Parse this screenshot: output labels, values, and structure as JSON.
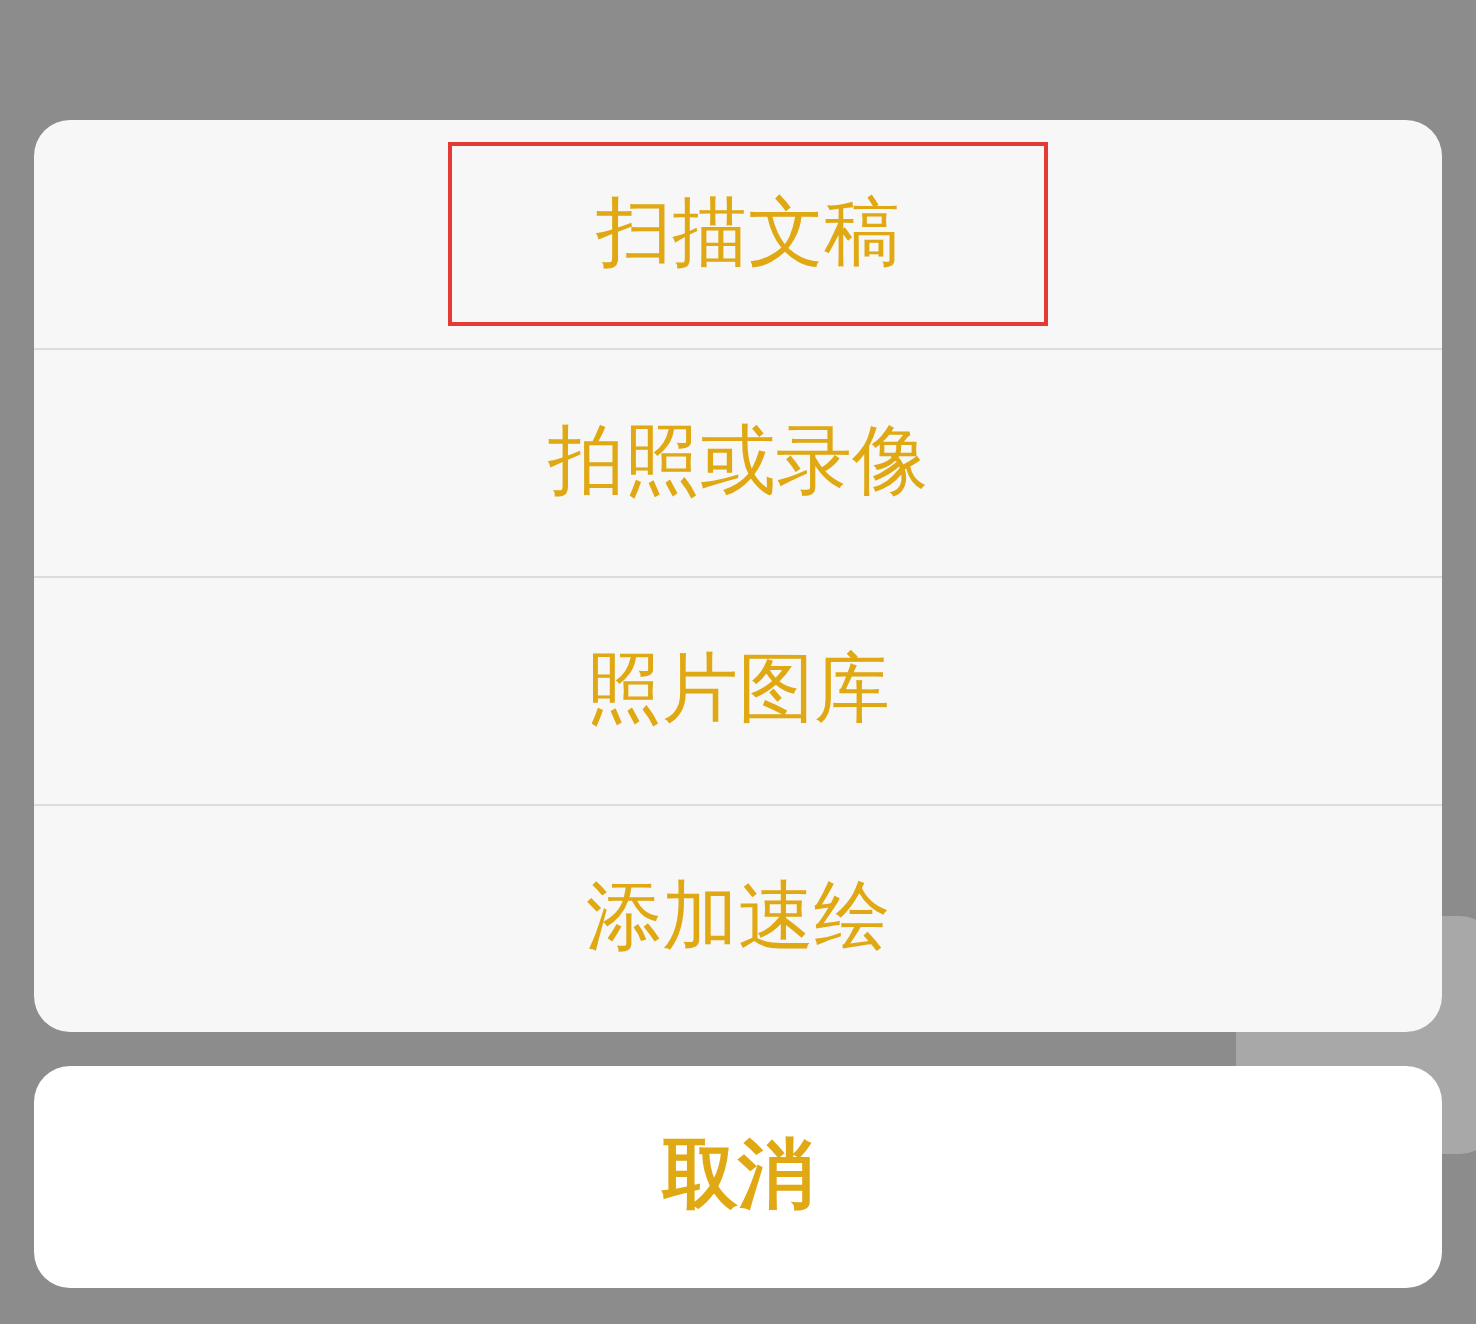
{
  "action_sheet": {
    "items": [
      {
        "label": "扫描文稿",
        "highlighted": true
      },
      {
        "label": "拍照或录像",
        "highlighted": false
      },
      {
        "label": "照片图库",
        "highlighted": false
      },
      {
        "label": "添加速绘",
        "highlighted": false
      }
    ]
  },
  "cancel_button": {
    "label": "取消"
  }
}
